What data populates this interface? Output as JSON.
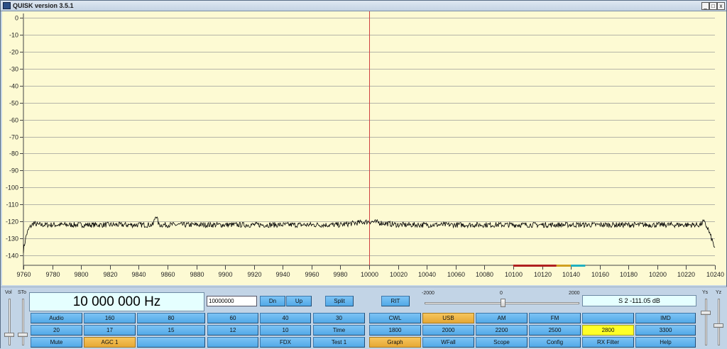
{
  "window": {
    "title": "QUISK version 3.5.1",
    "controls": [
      "_",
      "□",
      "x"
    ]
  },
  "graph": {
    "y_ticks": [
      "0",
      "-10",
      "-20",
      "-30",
      "-40",
      "-50",
      "-60",
      "-70",
      "-80",
      "-90",
      "-100",
      "-110",
      "-120",
      "-130",
      "-140"
    ],
    "x_ticks": [
      "9760",
      "9780",
      "9800",
      "9820",
      "9840",
      "9860",
      "9880",
      "9900",
      "9920",
      "9940",
      "9960",
      "9980",
      "10000",
      "10020",
      "10040",
      "10060",
      "10080",
      "10100",
      "10120",
      "10140",
      "10160",
      "10180",
      "10200",
      "10220",
      "10240"
    ]
  },
  "chart_data": {
    "type": "line",
    "title": "",
    "xlabel": "",
    "ylabel": "",
    "xlim": [
      9760,
      10240
    ],
    "ylim": [
      -145,
      0
    ],
    "grid": true,
    "center_line_x": 10000,
    "center_line_color": "#d04040",
    "line_color": "#000000",
    "band_markers": [
      {
        "from": 10100,
        "to": 10130,
        "color": "#b02020"
      },
      {
        "from": 10130,
        "to": 10140,
        "color": "#d0a020"
      },
      {
        "from": 10140,
        "to": 10150,
        "color": "#20b0c0"
      }
    ],
    "series": [
      {
        "x": [
          9760,
          9762,
          9764,
          9767,
          9770,
          9780,
          9800,
          9820,
          9840,
          9850,
          9852,
          9854,
          9870,
          9900,
          9940,
          9980,
          10000,
          10020,
          10060,
          10100,
          10140,
          10180,
          10220,
          10230,
          10232,
          10235,
          10238,
          10240
        ],
        "y": [
          -137,
          -128,
          -124,
          -121,
          -122,
          -122,
          -122,
          -122,
          -122,
          -122,
          -116,
          -122,
          -122,
          -122,
          -122,
          -122,
          -120,
          -122,
          -122,
          -122,
          -122,
          -122,
          -122,
          -122,
          -120,
          -124,
          -131,
          -136
        ]
      }
    ]
  },
  "controls": {
    "vol_label": "Vol",
    "sto_label": "STo",
    "ys_label": "Ys",
    "yz_label": "Yz",
    "frequency_display": "10 000 000 Hz",
    "frequency_input": "10000000",
    "dn": "Dn",
    "up": "Up",
    "split": "Split",
    "rit": "RIT",
    "rit_scale": [
      "-2000",
      "0",
      "2000"
    ],
    "rit_value": 0,
    "smeter": "S 2   -111.05 dB",
    "vol_level": 0.2,
    "sto_level": 0.2,
    "ys_level": 0.72,
    "yz_level": 0.42
  },
  "buttons": {
    "row1": [
      "Audio",
      "160",
      "80",
      "60",
      "40",
      "30",
      "CWL",
      "USB",
      "AM",
      "FM",
      "",
      "IMD"
    ],
    "row2": [
      "20",
      "17",
      "15",
      "12",
      "10",
      "Time",
      "1800",
      "2000",
      "2200",
      "2500",
      "2800",
      "3300"
    ],
    "row3": [
      "Mute",
      "AGC 1",
      "",
      "",
      "FDX",
      "Test 1",
      "Graph",
      "WFall",
      "Scope",
      "Config",
      "RX Filter",
      "Help"
    ]
  },
  "colors": {
    "button": "#5fb4ef",
    "button_active": "#eeb548",
    "button_highlight": "#ffff27",
    "graph_bg": "#fdfad3",
    "display_bg": "#e5ffff"
  }
}
